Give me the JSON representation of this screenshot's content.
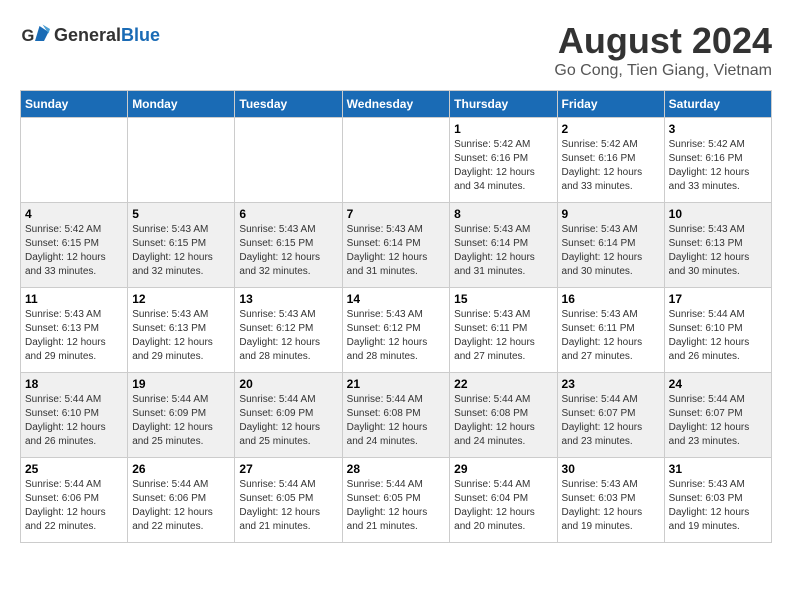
{
  "header": {
    "logo": {
      "general": "General",
      "blue": "Blue"
    },
    "title": "August 2024",
    "location": "Go Cong, Tien Giang, Vietnam"
  },
  "calendar": {
    "weekdays": [
      "Sunday",
      "Monday",
      "Tuesday",
      "Wednesday",
      "Thursday",
      "Friday",
      "Saturday"
    ],
    "weeks": [
      [
        {
          "day": "",
          "info": ""
        },
        {
          "day": "",
          "info": ""
        },
        {
          "day": "",
          "info": ""
        },
        {
          "day": "",
          "info": ""
        },
        {
          "day": "1",
          "info": "Sunrise: 5:42 AM\nSunset: 6:16 PM\nDaylight: 12 hours\nand 34 minutes."
        },
        {
          "day": "2",
          "info": "Sunrise: 5:42 AM\nSunset: 6:16 PM\nDaylight: 12 hours\nand 33 minutes."
        },
        {
          "day": "3",
          "info": "Sunrise: 5:42 AM\nSunset: 6:16 PM\nDaylight: 12 hours\nand 33 minutes."
        }
      ],
      [
        {
          "day": "4",
          "info": "Sunrise: 5:42 AM\nSunset: 6:15 PM\nDaylight: 12 hours\nand 33 minutes."
        },
        {
          "day": "5",
          "info": "Sunrise: 5:43 AM\nSunset: 6:15 PM\nDaylight: 12 hours\nand 32 minutes."
        },
        {
          "day": "6",
          "info": "Sunrise: 5:43 AM\nSunset: 6:15 PM\nDaylight: 12 hours\nand 32 minutes."
        },
        {
          "day": "7",
          "info": "Sunrise: 5:43 AM\nSunset: 6:14 PM\nDaylight: 12 hours\nand 31 minutes."
        },
        {
          "day": "8",
          "info": "Sunrise: 5:43 AM\nSunset: 6:14 PM\nDaylight: 12 hours\nand 31 minutes."
        },
        {
          "day": "9",
          "info": "Sunrise: 5:43 AM\nSunset: 6:14 PM\nDaylight: 12 hours\nand 30 minutes."
        },
        {
          "day": "10",
          "info": "Sunrise: 5:43 AM\nSunset: 6:13 PM\nDaylight: 12 hours\nand 30 minutes."
        }
      ],
      [
        {
          "day": "11",
          "info": "Sunrise: 5:43 AM\nSunset: 6:13 PM\nDaylight: 12 hours\nand 29 minutes."
        },
        {
          "day": "12",
          "info": "Sunrise: 5:43 AM\nSunset: 6:13 PM\nDaylight: 12 hours\nand 29 minutes."
        },
        {
          "day": "13",
          "info": "Sunrise: 5:43 AM\nSunset: 6:12 PM\nDaylight: 12 hours\nand 28 minutes."
        },
        {
          "day": "14",
          "info": "Sunrise: 5:43 AM\nSunset: 6:12 PM\nDaylight: 12 hours\nand 28 minutes."
        },
        {
          "day": "15",
          "info": "Sunrise: 5:43 AM\nSunset: 6:11 PM\nDaylight: 12 hours\nand 27 minutes."
        },
        {
          "day": "16",
          "info": "Sunrise: 5:43 AM\nSunset: 6:11 PM\nDaylight: 12 hours\nand 27 minutes."
        },
        {
          "day": "17",
          "info": "Sunrise: 5:44 AM\nSunset: 6:10 PM\nDaylight: 12 hours\nand 26 minutes."
        }
      ],
      [
        {
          "day": "18",
          "info": "Sunrise: 5:44 AM\nSunset: 6:10 PM\nDaylight: 12 hours\nand 26 minutes."
        },
        {
          "day": "19",
          "info": "Sunrise: 5:44 AM\nSunset: 6:09 PM\nDaylight: 12 hours\nand 25 minutes."
        },
        {
          "day": "20",
          "info": "Sunrise: 5:44 AM\nSunset: 6:09 PM\nDaylight: 12 hours\nand 25 minutes."
        },
        {
          "day": "21",
          "info": "Sunrise: 5:44 AM\nSunset: 6:08 PM\nDaylight: 12 hours\nand 24 minutes."
        },
        {
          "day": "22",
          "info": "Sunrise: 5:44 AM\nSunset: 6:08 PM\nDaylight: 12 hours\nand 24 minutes."
        },
        {
          "day": "23",
          "info": "Sunrise: 5:44 AM\nSunset: 6:07 PM\nDaylight: 12 hours\nand 23 minutes."
        },
        {
          "day": "24",
          "info": "Sunrise: 5:44 AM\nSunset: 6:07 PM\nDaylight: 12 hours\nand 23 minutes."
        }
      ],
      [
        {
          "day": "25",
          "info": "Sunrise: 5:44 AM\nSunset: 6:06 PM\nDaylight: 12 hours\nand 22 minutes."
        },
        {
          "day": "26",
          "info": "Sunrise: 5:44 AM\nSunset: 6:06 PM\nDaylight: 12 hours\nand 22 minutes."
        },
        {
          "day": "27",
          "info": "Sunrise: 5:44 AM\nSunset: 6:05 PM\nDaylight: 12 hours\nand 21 minutes."
        },
        {
          "day": "28",
          "info": "Sunrise: 5:44 AM\nSunset: 6:05 PM\nDaylight: 12 hours\nand 21 minutes."
        },
        {
          "day": "29",
          "info": "Sunrise: 5:44 AM\nSunset: 6:04 PM\nDaylight: 12 hours\nand 20 minutes."
        },
        {
          "day": "30",
          "info": "Sunrise: 5:43 AM\nSunset: 6:03 PM\nDaylight: 12 hours\nand 19 minutes."
        },
        {
          "day": "31",
          "info": "Sunrise: 5:43 AM\nSunset: 6:03 PM\nDaylight: 12 hours\nand 19 minutes."
        }
      ]
    ]
  }
}
